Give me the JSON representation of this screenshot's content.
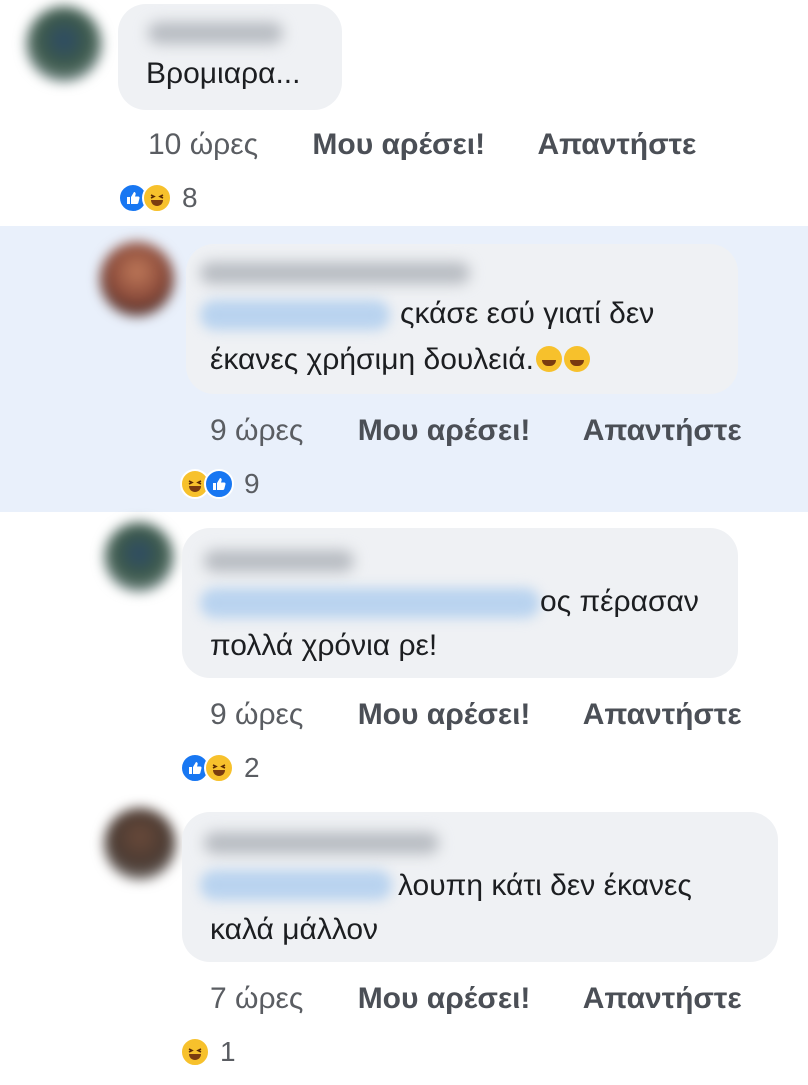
{
  "comments": [
    {
      "text_line1": "Βρομιαρα...",
      "time": "10 ώρες",
      "like": "Μου αρέσει!",
      "reply": "Απαντήστε",
      "reaction_icons": [
        "like-icon",
        "haha-icon"
      ],
      "reaction_count": "8"
    },
    {
      "text_line1": "ςκάσε εσύ γιατί δεν",
      "text_line2": "έκανες  χρήσιμη δουλειά.",
      "emojis": "🤣🤣",
      "time": "9 ώρες",
      "like": "Μου αρέσει!",
      "reply": "Απαντήστε",
      "reaction_icons": [
        "haha-icon",
        "like-icon"
      ],
      "reaction_count": "9"
    },
    {
      "text_line1": "ος πέρασαν",
      "text_line2": "πολλά χρόνια ρε!",
      "time": "9 ώρες",
      "like": "Μου αρέσει!",
      "reply": "Απαντήστε",
      "reaction_icons": [
        "like-icon",
        "haha-icon"
      ],
      "reaction_count": "2"
    },
    {
      "text_line1": "λουπη κάτι δεν έκανες",
      "text_line2": "καλά μάλλον",
      "time": "7 ώρες",
      "like": "Μου αρέσει!",
      "reply": "Απαντήστε",
      "reaction_icons": [
        "haha-icon"
      ],
      "reaction_count": "1"
    }
  ],
  "colors": {
    "highlight_bg": "#e9f0fb",
    "bubble_bg": "#eff1f4",
    "like_blue": "#1877f2",
    "haha_yellow": "#f7c12c"
  }
}
